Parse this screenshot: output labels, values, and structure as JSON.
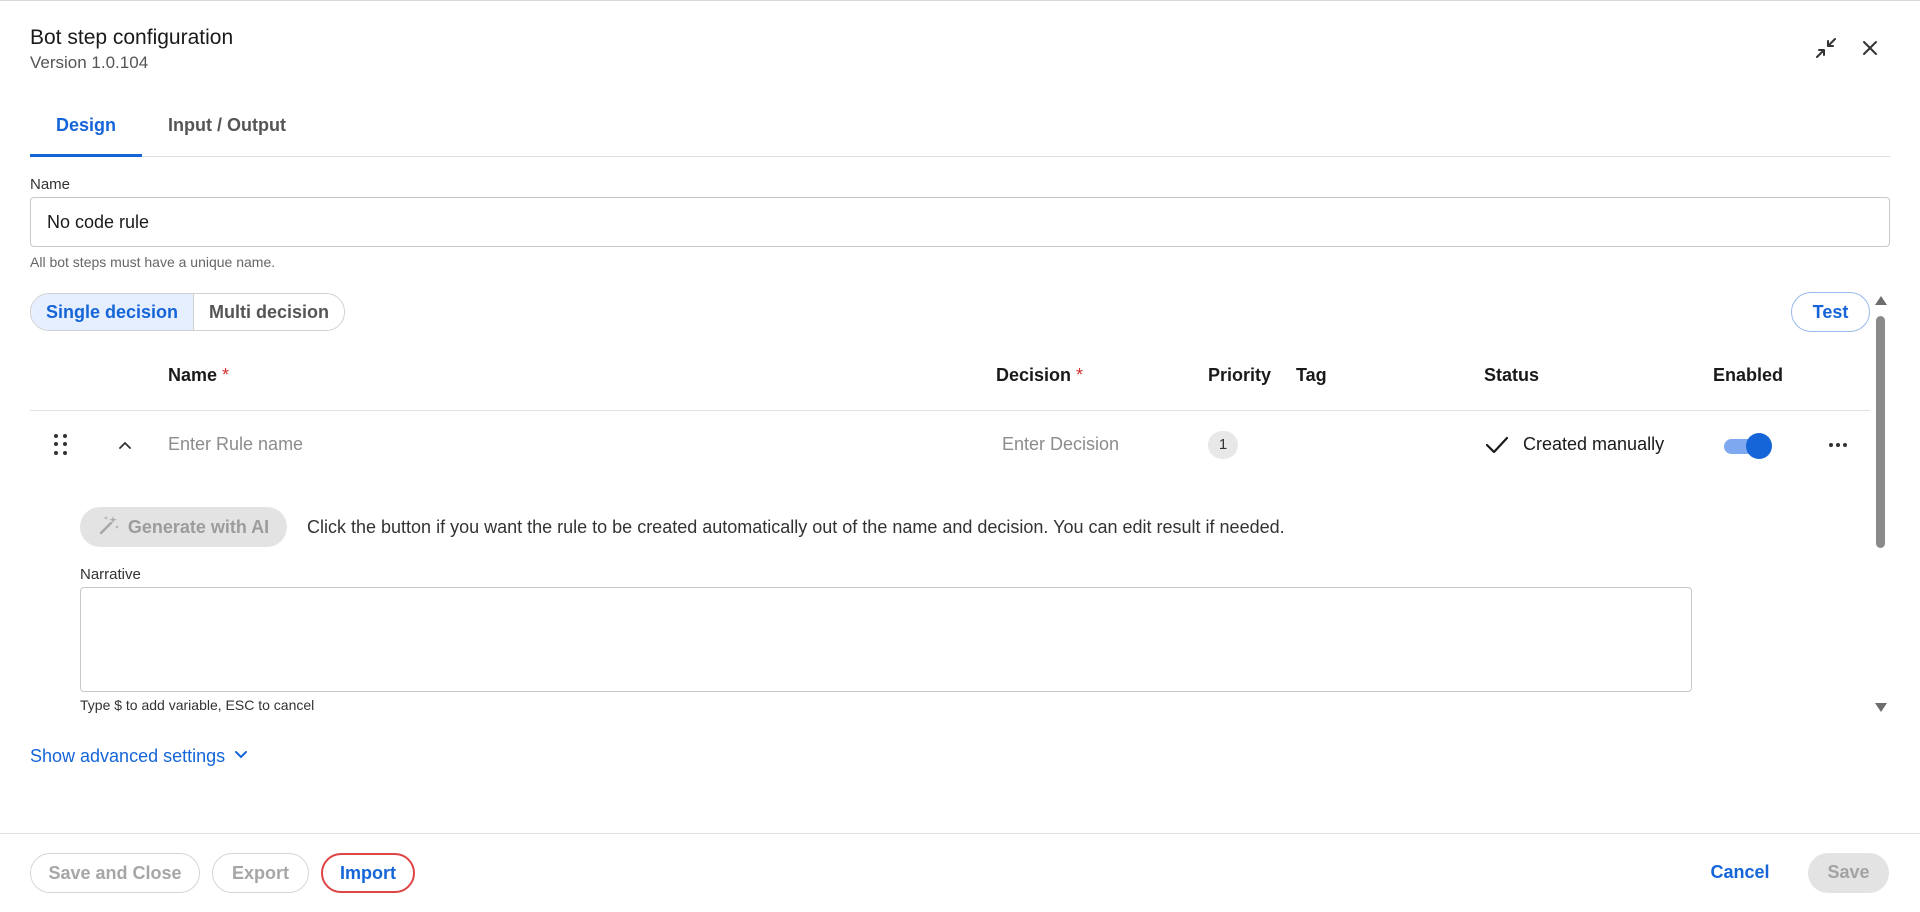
{
  "header": {
    "title": "Bot step configuration",
    "version": "Version 1.0.104"
  },
  "tabs": [
    {
      "label": "Design",
      "active": true
    },
    {
      "label": "Input / Output",
      "active": false
    }
  ],
  "name_field": {
    "label": "Name",
    "value": "No code rule",
    "help": "All bot steps must have a unique name."
  },
  "mode_toggle": {
    "single": "Single decision",
    "multi": "Multi decision",
    "selected": "Single decision"
  },
  "test_label": "Test",
  "table": {
    "headers": {
      "name": "Name",
      "decision": "Decision",
      "priority": "Priority",
      "tag": "Tag",
      "status": "Status",
      "enabled": "Enabled"
    },
    "required_mark": "*",
    "row": {
      "name_placeholder": "Enter Rule name",
      "decision_placeholder": "Enter Decision",
      "priority": "1",
      "status": "Created manually",
      "enabled": true
    }
  },
  "generate": {
    "label": "Generate with AI",
    "description": "Click the button if you want the rule to be created automatically out of the name and decision. You can edit result if needed."
  },
  "narrative": {
    "label": "Narrative",
    "help": "Type $ to add variable, ESC to cancel"
  },
  "advanced_label": "Show advanced settings",
  "footer": {
    "save_close": "Save and Close",
    "export": "Export",
    "import": "Import",
    "cancel": "Cancel",
    "save": "Save"
  },
  "colors": {
    "accent": "#1565d8",
    "highlight_ring": "#e04545",
    "required": "#d32f2f"
  }
}
